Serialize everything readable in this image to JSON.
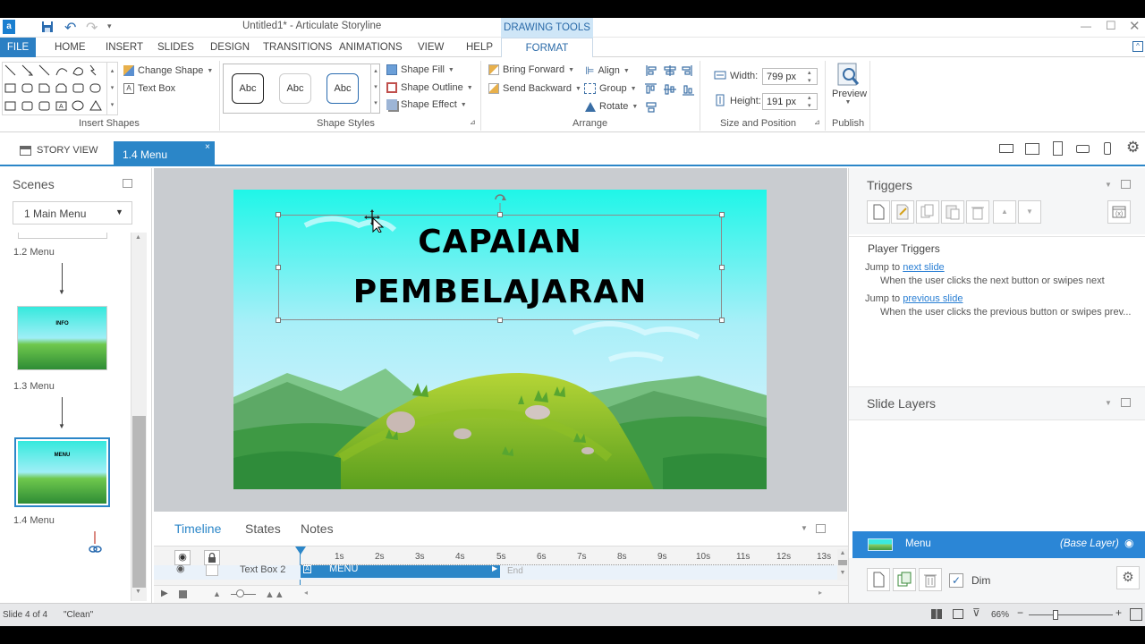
{
  "window": {
    "title": "Untitled1* -  Articulate Storyline",
    "contextual_tab": "DRAWING TOOLS"
  },
  "menu": {
    "file": "FILE",
    "items": [
      "HOME",
      "INSERT",
      "SLIDES",
      "DESIGN",
      "TRANSITIONS",
      "ANIMATIONS",
      "VIEW",
      "HELP"
    ],
    "format": "FORMAT"
  },
  "ribbon": {
    "insert_shapes": {
      "label": "Insert Shapes",
      "change_shape": "Change Shape",
      "text_box": "Text Box"
    },
    "shape_styles": {
      "label": "Shape Styles",
      "style_sample": "Abc",
      "fill": "Shape Fill",
      "outline": "Shape Outline",
      "effect": "Shape Effect"
    },
    "arrange": {
      "label": "Arrange",
      "bring_forward": "Bring Forward",
      "send_backward": "Send Backward",
      "align": "Align",
      "group": "Group",
      "rotate": "Rotate"
    },
    "size": {
      "label": "Size and Position",
      "width_label": "Width:",
      "width": "799 px",
      "height_label": "Height:",
      "height": "191 px"
    },
    "publish": {
      "label": "Publish",
      "preview": "Preview"
    }
  },
  "tabs": {
    "story_view": "STORY VIEW",
    "current": "1.4 Menu"
  },
  "scenes": {
    "title": "Scenes",
    "selected": "1 Main Menu",
    "slides": [
      {
        "label": "1.2 Menu",
        "thumb_text": "INFO"
      },
      {
        "label": "1.3 Menu",
        "thumb_text": "MENU"
      },
      {
        "label": "1.4 Menu"
      }
    ]
  },
  "slide": {
    "line1": "CAPAIAN",
    "line2": "PEMBELAJARAN"
  },
  "timeline": {
    "tabs": [
      "Timeline",
      "States",
      "Notes"
    ],
    "ticks": [
      "1s",
      "2s",
      "3s",
      "4s",
      "5s",
      "6s",
      "7s",
      "8s",
      "9s",
      "10s",
      "11s",
      "12s",
      "13s"
    ],
    "row_name": "Text Box 2",
    "bar_label": "MENU",
    "end_label": "End"
  },
  "triggers": {
    "title": "Triggers",
    "section": "Player Triggers",
    "items": [
      {
        "prefix": "Jump to",
        "link": "next slide",
        "desc": "When the user clicks the next button or swipes next"
      },
      {
        "prefix": "Jump to",
        "link": "previous slide",
        "desc": "When the user clicks the previous button or swipes prev..."
      }
    ]
  },
  "layers": {
    "title": "Slide Layers",
    "base_name": "Menu",
    "base_tag": "(Base Layer)",
    "dim": "Dim"
  },
  "status": {
    "slide": "Slide 4 of 4",
    "theme": "\"Clean\"",
    "zoom": "66%"
  },
  "colors": {
    "accent": "#2b86c8",
    "file_tab": "#2b7fc3",
    "selected_layer": "#2b86d6",
    "link": "#2a7fd4"
  }
}
